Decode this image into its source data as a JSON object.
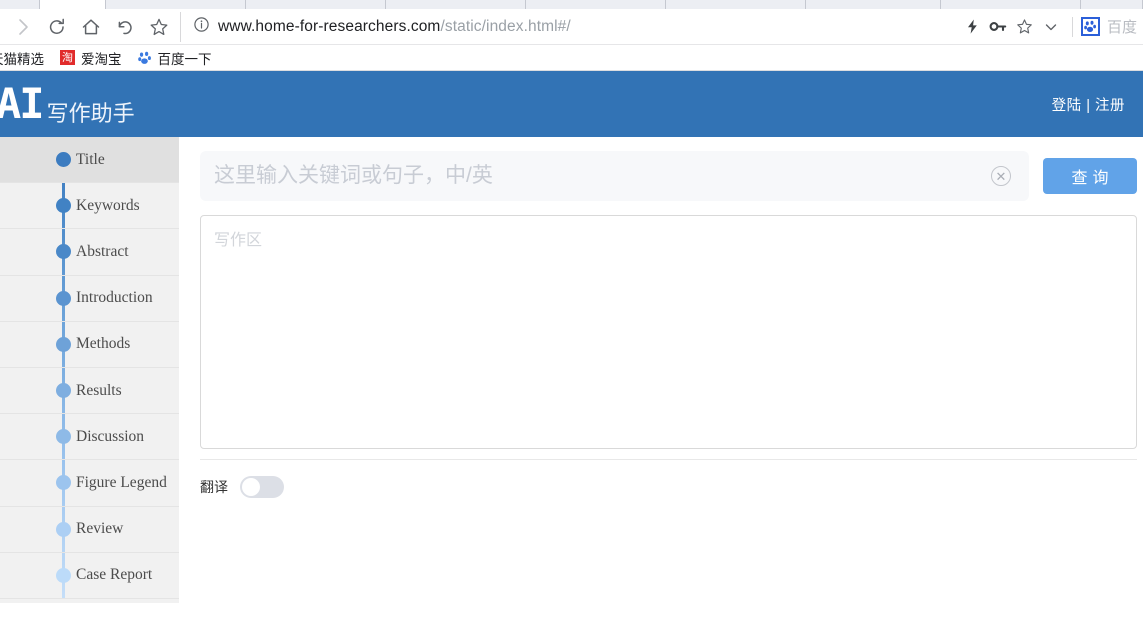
{
  "browser": {
    "tabs": [
      {
        "label": "",
        "active": false,
        "width": 40
      },
      {
        "label": "",
        "active": true,
        "width": 66
      },
      {
        "label": "",
        "active": false,
        "width": 140
      },
      {
        "label": "",
        "active": false,
        "width": 140
      },
      {
        "label": "",
        "active": false,
        "width": 140
      },
      {
        "label": "",
        "active": false,
        "width": 140
      },
      {
        "label": "",
        "active": false,
        "width": 140
      },
      {
        "label": "",
        "active": false,
        "width": 135
      },
      {
        "label": "",
        "active": false,
        "width": 140
      },
      {
        "label": "",
        "active": false,
        "width": 62
      }
    ],
    "nav": [
      {
        "name": "forward-icon",
        "glyph": "forward"
      },
      {
        "name": "reload-icon",
        "glyph": "reload"
      },
      {
        "name": "home-icon",
        "glyph": "home"
      },
      {
        "name": "back-arrow-icon",
        "glyph": "undo"
      },
      {
        "name": "bookmark-star-icon",
        "glyph": "star"
      }
    ],
    "url": {
      "domain": "www.home-for-researchers.com",
      "path": "/static/index.html#/",
      "security_icon": "info-circle-icon"
    },
    "toolbar_right": [
      {
        "name": "lightning-icon",
        "glyph": "bolt"
      },
      {
        "name": "key-icon",
        "glyph": "key"
      },
      {
        "name": "favorite-star-icon",
        "glyph": "star"
      },
      {
        "name": "chevron-down-icon",
        "glyph": "chevron"
      }
    ],
    "search_engine_chip": {
      "icon": "baidu-paw-icon",
      "label": "百度"
    },
    "bookmarks": [
      {
        "label": "天猫精选",
        "icon": "none"
      },
      {
        "label": "爱淘宝",
        "icon": "taobao-icon",
        "icon_char": "淘"
      },
      {
        "label": "百度一下",
        "icon": "baidu-paw-icon"
      }
    ]
  },
  "header": {
    "logo_mark": "AI",
    "logo_text": "写作助手",
    "auth_label": "登陆 | 注册",
    "brand_color": "#3273b5"
  },
  "sidebar": {
    "items": [
      {
        "label": "Title",
        "active": true,
        "dot_color": "#3c7cc0"
      },
      {
        "label": "Keywords",
        "active": false,
        "dot_color": "#4182c4"
      },
      {
        "label": "Abstract",
        "active": false,
        "dot_color": "#4a88c8"
      },
      {
        "label": "Introduction",
        "active": false,
        "dot_color": "#5b94d0"
      },
      {
        "label": "Methods",
        "active": false,
        "dot_color": "#6ea2d8"
      },
      {
        "label": "Results",
        "active": false,
        "dot_color": "#7eaee0"
      },
      {
        "label": "Discussion",
        "active": false,
        "dot_color": "#8ebae7"
      },
      {
        "label": "Figure Legend",
        "active": false,
        "dot_color": "#9cc4ee"
      },
      {
        "label": "Review",
        "active": false,
        "dot_color": "#accff4"
      },
      {
        "label": "Case Report",
        "active": false,
        "dot_color": "#bcdbf9"
      }
    ]
  },
  "main": {
    "search": {
      "value": "",
      "placeholder": "这里输入关键词或句子，中/英",
      "clear_icon": "clear-circle-icon",
      "query_label": "查询",
      "query_color": "#61a3e8"
    },
    "editor": {
      "value": "",
      "placeholder": "写作区"
    },
    "translate": {
      "label": "翻译",
      "enabled": false
    }
  }
}
